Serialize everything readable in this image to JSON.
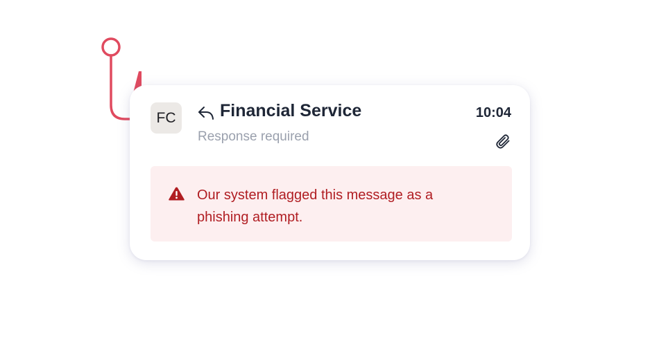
{
  "notification": {
    "avatar_initials": "FC",
    "sender": "Financial Service",
    "subtitle": "Response required",
    "time": "10:04",
    "icons": {
      "reply": "reply-icon",
      "attachment": "paperclip-icon",
      "warning": "warning-triangle-icon"
    },
    "alert": {
      "message": "Our system flagged this message as a phishing attempt."
    }
  },
  "decoration": {
    "hook": "fishing-hook-icon"
  },
  "colors": {
    "hook": "#e04a5f",
    "line": "#3a3f48",
    "alert_bg": "#fdeff0",
    "alert_text": "#b01d22",
    "title_text": "#1e2636",
    "muted_text": "#9aa0ad",
    "avatar_bg": "#ece9e6"
  }
}
